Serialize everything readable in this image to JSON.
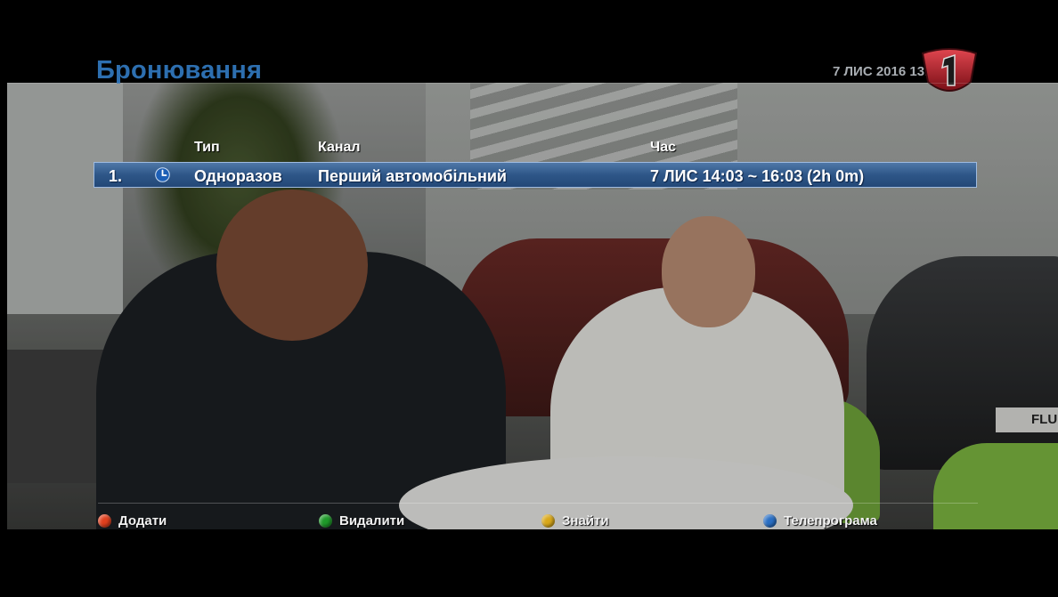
{
  "header": {
    "title": "Бронювання",
    "datetime": "7 ЛИС 2016 13:53"
  },
  "table": {
    "columns": {
      "type": "Тип",
      "channel": "Канал",
      "time": "Час"
    },
    "rows": [
      {
        "index": "1.",
        "icon": "clock-icon",
        "type": "Одноразов",
        "channel": "Перший автомобільний",
        "time": "7 ЛИС 14:03 ~ 16:03 (2h 0m)"
      }
    ]
  },
  "footer": {
    "buttons": [
      {
        "label": "Додати",
        "color": "#e0401e"
      },
      {
        "label": "Видалити",
        "color": "#1f9a2a"
      },
      {
        "label": "Знайти",
        "color": "#d9a81a"
      },
      {
        "label": "Телепрограма",
        "color": "#2a6fc4"
      }
    ]
  },
  "colors": {
    "accent": "#2d6fb0",
    "selection": "#2e5688"
  },
  "video": {
    "plate_text": "FLU"
  }
}
